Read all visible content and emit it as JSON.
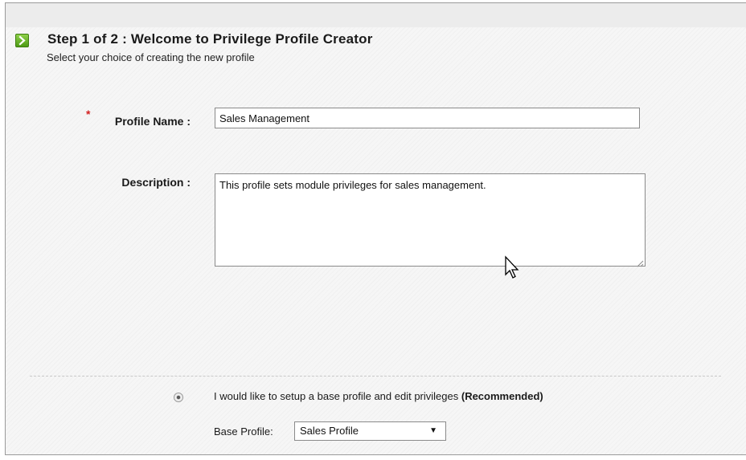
{
  "step": {
    "title": "Step 1 of 2 : Welcome to Privilege Profile Creator",
    "subtitle": "Select your choice of creating the new profile",
    "icon": "arrow-right-icon",
    "icon_color": "#6dbb2e"
  },
  "form": {
    "required_marker": "*",
    "profile_name_label": "Profile Name :",
    "profile_name_value": "Sales Management",
    "description_label": "Description :",
    "description_value": "This profile sets module privileges for sales management."
  },
  "options": {
    "base_profile_option_text": "I would like to setup a base profile and edit privileges ",
    "base_profile_option_emphasis": "(Recommended)",
    "base_profile_option_selected": true,
    "base_profile_label": "Base Profile:",
    "base_profile_selected": "Sales Profile"
  },
  "colors": {
    "required": "#d21f1f",
    "accent_icon": "#6dbb2e"
  }
}
